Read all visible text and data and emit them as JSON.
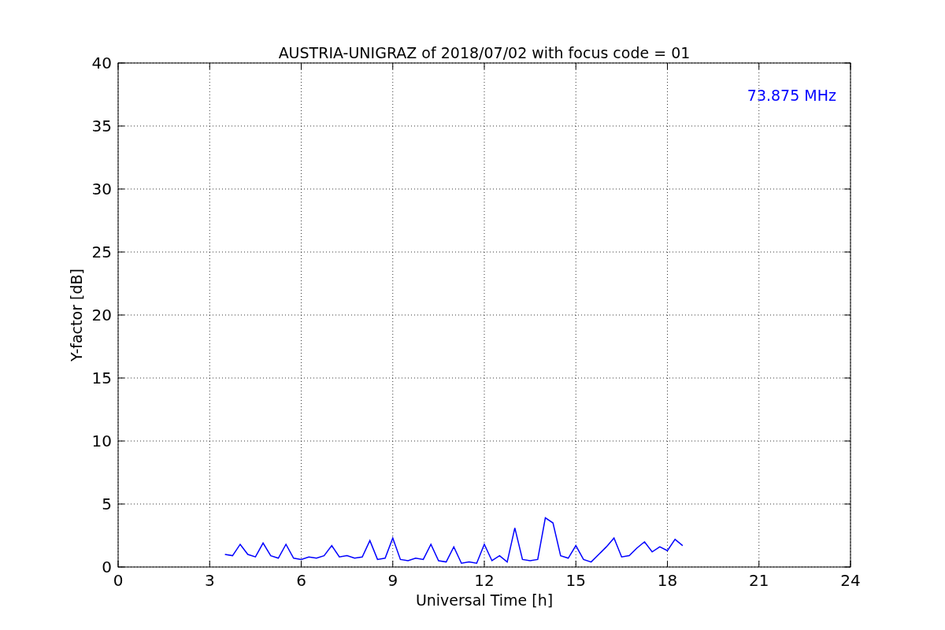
{
  "chart_data": {
    "type": "line",
    "title": "AUSTRIA-UNIGRAZ of 2018/07/02 with focus code = 01",
    "xlabel": "Universal Time [h]",
    "ylabel": "Y-factor [dB]",
    "x": [
      3.5,
      3.75,
      4.0,
      4.25,
      4.5,
      4.75,
      5.0,
      5.25,
      5.5,
      5.75,
      6.0,
      6.25,
      6.5,
      6.75,
      7.0,
      7.25,
      7.5,
      7.75,
      8.0,
      8.25,
      8.5,
      8.75,
      9.0,
      9.25,
      9.5,
      9.75,
      10.0,
      10.25,
      10.5,
      10.75,
      11.0,
      11.25,
      11.5,
      11.75,
      12.0,
      12.25,
      12.5,
      12.75,
      13.0,
      13.25,
      13.5,
      13.75,
      14.0,
      14.25,
      14.5,
      14.75,
      15.0,
      15.25,
      15.5,
      15.75,
      16.0,
      16.25,
      16.5,
      16.75,
      17.0,
      17.25,
      17.5,
      17.75,
      18.0,
      18.25,
      18.5
    ],
    "series": [
      {
        "name": "73.875 MHz",
        "color": "#0000ff",
        "values": [
          1.0,
          0.9,
          1.8,
          1.0,
          0.8,
          1.9,
          0.9,
          0.7,
          1.8,
          0.7,
          0.6,
          0.8,
          0.7,
          0.9,
          1.7,
          0.8,
          0.9,
          0.7,
          0.8,
          2.1,
          0.6,
          0.7,
          2.3,
          0.6,
          0.5,
          0.7,
          0.6,
          1.8,
          0.5,
          0.4,
          1.6,
          0.3,
          0.4,
          0.3,
          1.8,
          0.5,
          0.9,
          0.4,
          3.1,
          0.6,
          0.5,
          0.6,
          3.9,
          3.5,
          0.9,
          0.7,
          1.7,
          0.6,
          0.4,
          1.0,
          1.6,
          2.3,
          0.8,
          0.9,
          1.5,
          2.0,
          1.2,
          1.6,
          1.3,
          2.2,
          1.7
        ]
      }
    ],
    "xlim": [
      0,
      24
    ],
    "ylim": [
      0,
      40
    ],
    "xticks": [
      0,
      3,
      6,
      9,
      12,
      15,
      18,
      21,
      24
    ],
    "yticks": [
      0,
      5,
      10,
      15,
      20,
      25,
      30,
      35,
      40
    ],
    "grid": true
  }
}
